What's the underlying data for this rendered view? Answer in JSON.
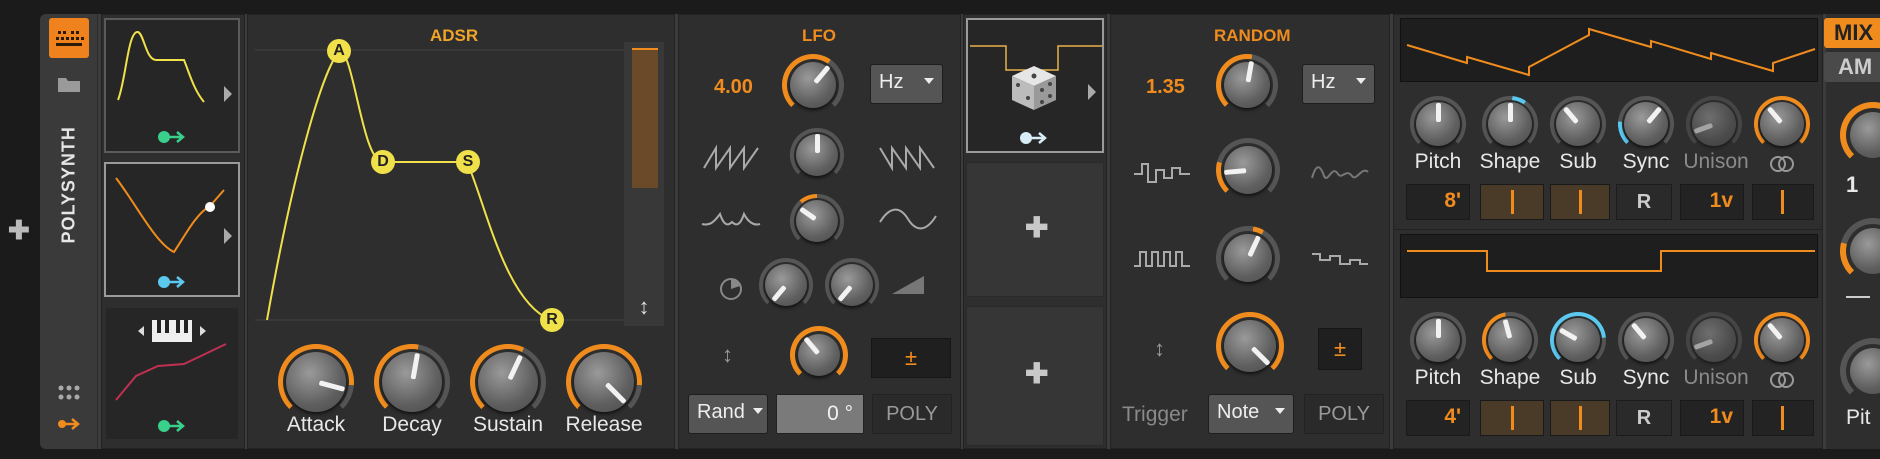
{
  "device": {
    "name": "POLYSYNTH"
  },
  "adsr": {
    "title": "ADSR",
    "points": [
      "A",
      "D",
      "S",
      "R"
    ],
    "knobs": [
      "Attack",
      "Decay",
      "Sustain",
      "Release"
    ]
  },
  "lfo": {
    "title": "LFO",
    "rate": "4.00",
    "unit": "Hz",
    "mode": "Rand",
    "phase": "0 °",
    "poly": "POLY",
    "plusminus": "±"
  },
  "random": {
    "title": "RANDOM",
    "rate": "1.35",
    "unit": "Hz",
    "trigger_label": "Trigger",
    "trigger": "Note",
    "poly": "POLY",
    "plusminus": "±"
  },
  "osc1": {
    "knobs": [
      "Pitch",
      "Shape",
      "Sub",
      "Sync",
      "Unison"
    ],
    "octave": "8'",
    "reset": "R",
    "voltage": "1v"
  },
  "osc2": {
    "knobs": [
      "Pitch",
      "Shape",
      "Sub",
      "Sync",
      "Unison"
    ],
    "octave": "4'",
    "reset": "R",
    "voltage": "1v"
  },
  "mixer": {
    "mix": "MIX",
    "am": "AM",
    "value": "1",
    "pitch_label": "Pit"
  },
  "colors": {
    "accent": "#f08c1e",
    "env": "#f0e04a",
    "mod_blue": "#5bc8f0",
    "mod_green": "#38d08a"
  }
}
